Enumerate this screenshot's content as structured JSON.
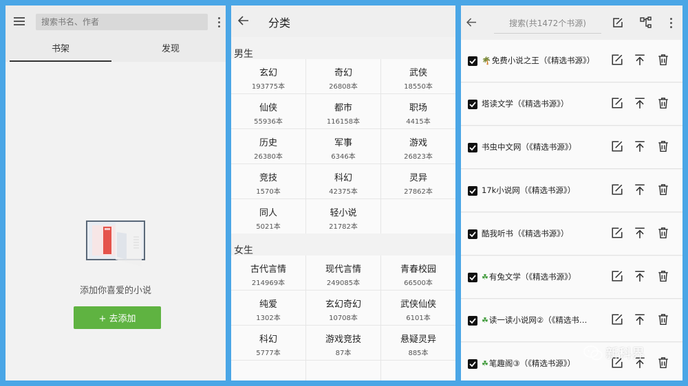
{
  "bookshelf": {
    "search_placeholder": "搜索书名、作者",
    "tabs": [
      {
        "label": "书架",
        "active": true
      },
      {
        "label": "发现",
        "active": false
      }
    ],
    "empty_text": "添加你喜爱的小说",
    "add_button": "+ 去添加"
  },
  "category": {
    "title": "分类",
    "sections": [
      {
        "title": "男生",
        "items": [
          {
            "name": "玄幻",
            "count": "193775本"
          },
          {
            "name": "奇幻",
            "count": "26808本"
          },
          {
            "name": "武侠",
            "count": "18550本"
          },
          {
            "name": "仙侠",
            "count": "55936本"
          },
          {
            "name": "都市",
            "count": "116158本"
          },
          {
            "name": "职场",
            "count": "4415本"
          },
          {
            "name": "历史",
            "count": "26380本"
          },
          {
            "name": "军事",
            "count": "6346本"
          },
          {
            "name": "游戏",
            "count": "26823本"
          },
          {
            "name": "竞技",
            "count": "1570本"
          },
          {
            "name": "科幻",
            "count": "42375本"
          },
          {
            "name": "灵异",
            "count": "27862本"
          },
          {
            "name": "同人",
            "count": "5021本"
          },
          {
            "name": "轻小说",
            "count": "21782本"
          },
          {
            "name": "",
            "count": ""
          }
        ]
      },
      {
        "title": "女生",
        "items": [
          {
            "name": "古代言情",
            "count": "214969本"
          },
          {
            "name": "现代言情",
            "count": "249085本"
          },
          {
            "name": "青春校园",
            "count": "66500本"
          },
          {
            "name": "纯爱",
            "count": "1302本"
          },
          {
            "name": "玄幻奇幻",
            "count": "10708本"
          },
          {
            "name": "武侠仙侠",
            "count": "6101本"
          },
          {
            "name": "科幻",
            "count": "5777本"
          },
          {
            "name": "游戏竞技",
            "count": "87本"
          },
          {
            "name": "悬疑灵异",
            "count": "885本"
          }
        ]
      }
    ]
  },
  "sources": {
    "search_placeholder": "搜索(共1472个书源)",
    "items": [
      {
        "name": "免费小说之王（《精选书源》）",
        "icon": "palm"
      },
      {
        "name": "塔读文学（《精选书源》）",
        "icon": ""
      },
      {
        "name": "书虫中文网（《精选书源》）",
        "icon": ""
      },
      {
        "name": "17k小说网（《精选书源》）",
        "icon": ""
      },
      {
        "name": "酷我听书（《精选书源》）",
        "icon": ""
      },
      {
        "name": "有兔文学（《精选书源》）",
        "icon": "clover"
      },
      {
        "name": "读一读小说网②（《精选书…",
        "icon": "clover"
      },
      {
        "name": "笔趣阁③（《精选书源》）",
        "icon": "clover"
      }
    ]
  },
  "watermark": "新科界",
  "colors": {
    "accent": "#5fb341",
    "frame": "#4aa6e6"
  }
}
